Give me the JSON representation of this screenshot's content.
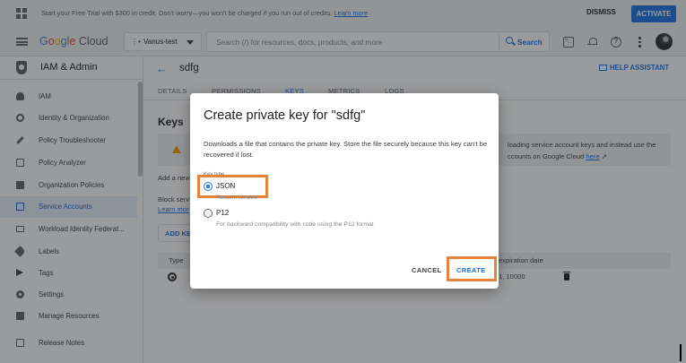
{
  "banner": {
    "text": "Start your Free Trial with $300 in credit. Don't worry—you won't be charged if you run out of credits.",
    "link": "Learn more",
    "dismiss": "DISMISS",
    "activate": "ACTIVATE"
  },
  "topbar": {
    "logo_g": [
      "G",
      "o",
      "o",
      "g",
      "l",
      "e"
    ],
    "logo_cloud": "Cloud",
    "project": "Vanus-test",
    "search_placeholder": "Search (/) for resources, docs, products, and more",
    "search_button": "Search"
  },
  "sidebar": {
    "title": "IAM & Admin",
    "items": [
      {
        "label": "IAM",
        "icon": "person-add-icon"
      },
      {
        "label": "Identity & Organization",
        "icon": "account-circle-icon"
      },
      {
        "label": "Policy Troubleshooter",
        "icon": "wrench-icon"
      },
      {
        "label": "Policy Analyzer",
        "icon": "document-search-icon"
      },
      {
        "label": "Organization Policies",
        "icon": "policy-document-icon"
      },
      {
        "label": "Service Accounts",
        "icon": "service-account-icon",
        "active": true
      },
      {
        "label": "Workload Identity Federat...",
        "icon": "id-card-icon"
      },
      {
        "label": "Labels",
        "icon": "label-icon"
      },
      {
        "label": "Tags",
        "icon": "tag-chevron-icon"
      },
      {
        "label": "Settings",
        "icon": "gear-icon"
      },
      {
        "label": "Manage Resources",
        "icon": "folder-icon"
      },
      {
        "label": "Release Notes",
        "icon": "release-notes-icon"
      }
    ]
  },
  "main": {
    "back_arrow": "←",
    "title": "sdfg",
    "help_assistant": "HELP ASSISTANT",
    "tabs": [
      "DETAILS",
      "PERMISSIONS",
      "KEYS",
      "METRICS",
      "LOGS"
    ],
    "selected_tab": "KEYS",
    "keys_heading": "Keys",
    "warning_text": "loading service account keys and instead use the",
    "warning_text2": "ccounts on Google Cloud",
    "warning_link": "here",
    "add_new_text": "Add a new",
    "block_text": "Block serv",
    "block_link": "Learn mor",
    "add_key_button": "ADD KE",
    "table": {
      "col_type": "Type",
      "col_expiration": "expiration date",
      "row_expiration": "1, 10000"
    }
  },
  "dialog": {
    "title": "Create private key for \"sdfg\"",
    "description": "Downloads a file that contains the private key. Store the file securely because this key can't be recovered if lost.",
    "key_type_label": "Key type",
    "options": [
      {
        "label": "JSON",
        "sub": "Recommended",
        "selected": true
      },
      {
        "label": "P12",
        "sub": "For backward compatibility with code using the P12 format",
        "selected": false
      }
    ],
    "cancel": "CANCEL",
    "create": "CREATE"
  },
  "colors": {
    "accent": "#1a73e8",
    "highlight": "#e8823a",
    "warning": "#f29900"
  }
}
